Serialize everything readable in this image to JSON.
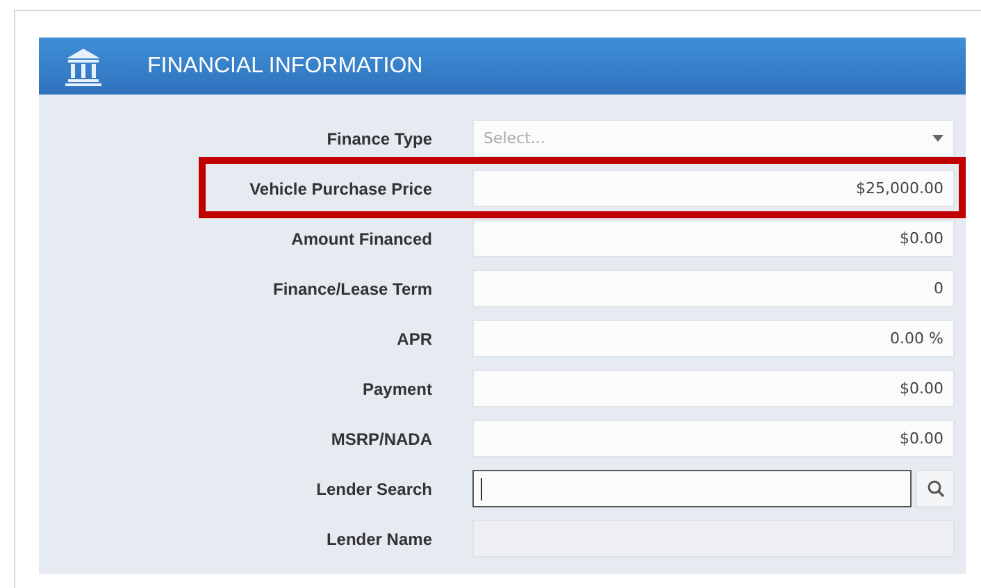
{
  "panel": {
    "title": "FINANCIAL INFORMATION"
  },
  "fields": [
    {
      "kind": "select",
      "label": "Finance Type",
      "placeholder": "Select...",
      "highlighted": false
    },
    {
      "kind": "text",
      "label": "Vehicle Purchase Price",
      "value": "$25,000.00",
      "highlighted": true
    },
    {
      "kind": "text",
      "label": "Amount Financed",
      "value": "$0.00",
      "highlighted": false
    },
    {
      "kind": "text",
      "label": "Finance/Lease Term",
      "value": "0",
      "highlighted": false
    },
    {
      "kind": "text",
      "label": "APR",
      "value": "0.00 %",
      "highlighted": false
    },
    {
      "kind": "text",
      "label": "Payment",
      "value": "$0.00",
      "highlighted": false
    },
    {
      "kind": "text",
      "label": "MSRP/NADA",
      "value": "$0.00",
      "highlighted": false
    },
    {
      "kind": "search",
      "label": "Lender Search",
      "focused": true,
      "highlighted": false
    },
    {
      "kind": "text",
      "label": "Lender Name",
      "disabled": true,
      "highlighted": false
    }
  ]
}
